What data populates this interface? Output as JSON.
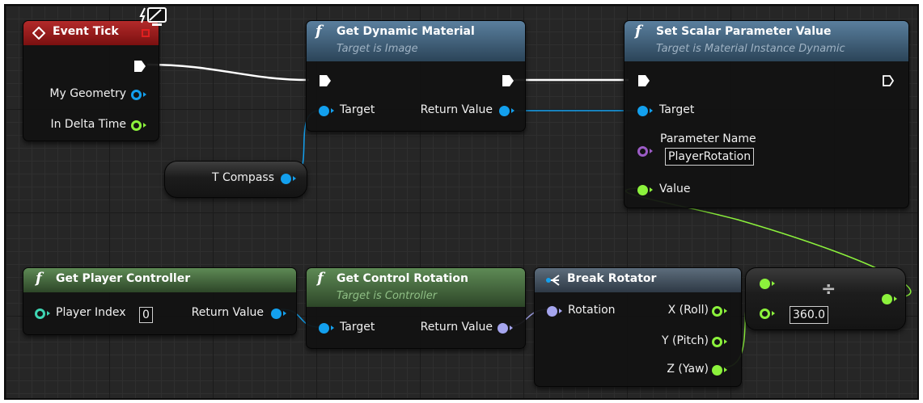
{
  "event_tick": {
    "title": "Event Tick",
    "pins": {
      "my_geometry": "My Geometry",
      "in_delta_time": "In Delta Time"
    }
  },
  "get_dynamic_material": {
    "title": "Get Dynamic Material",
    "subtitle": "Target is Image",
    "pins": {
      "target": "Target",
      "return_value": "Return Value"
    }
  },
  "set_scalar": {
    "title": "Set Scalar Parameter Value",
    "subtitle": "Target is Material Instance Dynamic",
    "pins": {
      "target": "Target",
      "parameter_name": "Parameter Name",
      "parameter_value": "PlayerRotation",
      "value": "Value"
    }
  },
  "t_compass": {
    "label": "T Compass"
  },
  "get_player_controller": {
    "title": "Get Player Controller",
    "pins": {
      "player_index": "Player Index",
      "player_index_value": "0",
      "return_value": "Return Value"
    }
  },
  "get_control_rotation": {
    "title": "Get Control Rotation",
    "subtitle": "Target is Controller",
    "pins": {
      "target": "Target",
      "return_value": "Return Value"
    }
  },
  "break_rotator": {
    "title": "Break Rotator",
    "pins": {
      "rotation": "Rotation",
      "x_roll": "X (Roll)",
      "y_pitch": "Y (Pitch)",
      "z_yaw": "Z (Yaw)"
    }
  },
  "divide": {
    "symbol": "÷",
    "divisor": "360.0"
  },
  "colors": {
    "exec": "#ffffff",
    "object": "#13a0ee",
    "float": "#8cf23c",
    "struct": "#a5a5ee",
    "name": "#9c5cc6",
    "event": "#a31a1a"
  }
}
